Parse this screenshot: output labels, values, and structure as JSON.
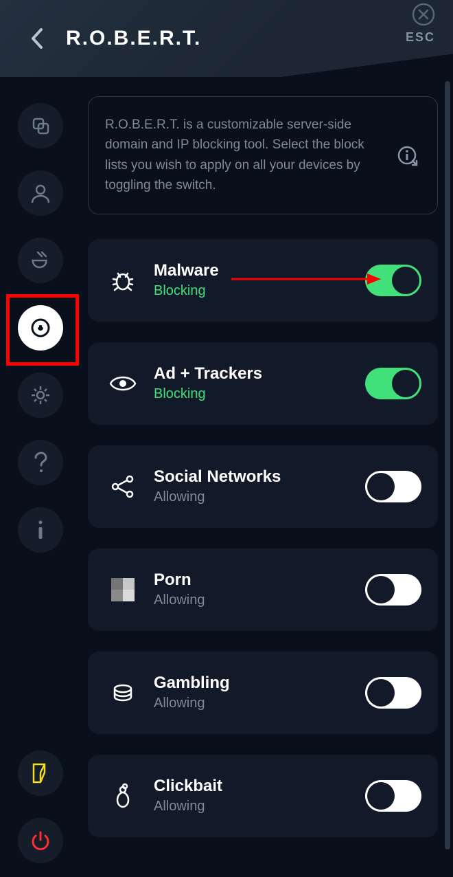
{
  "header": {
    "title": "R.O.B.E.R.T.",
    "esc_label": "ESC"
  },
  "info": {
    "text": "R.O.B.E.R.T. is a customizable server-side domain and IP blocking tool. Select the block lists you wish to apply on all your devices by toggling the switch."
  },
  "status_labels": {
    "on": "Blocking",
    "off": "Allowing"
  },
  "items": [
    {
      "key": "malware",
      "title": "Malware",
      "on": true,
      "icon": "bug-icon"
    },
    {
      "key": "adtrackers",
      "title": "Ad + Trackers",
      "on": true,
      "icon": "eye-icon"
    },
    {
      "key": "social",
      "title": "Social Networks",
      "on": false,
      "icon": "network-icon"
    },
    {
      "key": "porn",
      "title": "Porn",
      "on": false,
      "icon": "pixel-icon"
    },
    {
      "key": "gambling",
      "title": "Gambling",
      "on": false,
      "icon": "chips-icon"
    },
    {
      "key": "clickbait",
      "title": "Clickbait",
      "on": false,
      "icon": "bait-icon"
    }
  ],
  "sidebar": {
    "items": [
      {
        "key": "split",
        "icon": "split-icon"
      },
      {
        "key": "account",
        "icon": "user-icon"
      },
      {
        "key": "plug",
        "icon": "plug-icon"
      },
      {
        "key": "robert",
        "icon": "robert-icon",
        "active": true
      },
      {
        "key": "settings",
        "icon": "gear-icon"
      },
      {
        "key": "help",
        "icon": "help-icon"
      },
      {
        "key": "info",
        "icon": "info-icon"
      }
    ],
    "bottom": [
      {
        "key": "logout",
        "icon": "logout-icon"
      },
      {
        "key": "power",
        "icon": "power-icon"
      }
    ]
  }
}
